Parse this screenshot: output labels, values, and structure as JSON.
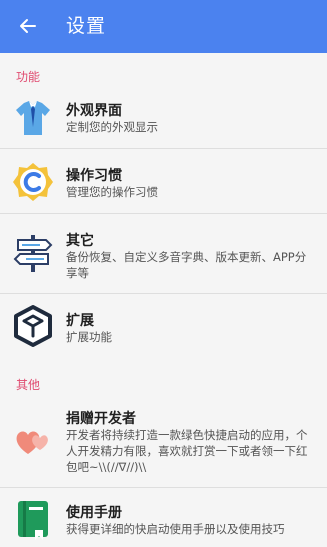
{
  "appbar": {
    "title": "设置",
    "back_icon": "arrow-left-icon"
  },
  "sections": {
    "features": {
      "label": "功能"
    },
    "other": {
      "label": "其他"
    }
  },
  "items": [
    {
      "title": "外观界面",
      "desc": "定制您的外观显示",
      "icon": "shirt-icon"
    },
    {
      "title": "操作习惯",
      "desc": "管理您的操作习惯",
      "icon": "c-gear-icon"
    },
    {
      "title": "其它",
      "desc": "备份恢复、自定义多音字典、版本更新、APP分享等",
      "icon": "signpost-icon"
    },
    {
      "title": "扩展",
      "desc": "扩展功能",
      "icon": "cube-icon"
    },
    {
      "title": "捐赠开发者",
      "desc": "开发者将持续打造一款绿色快捷启动的应用，个人开发精力有限，喜欢就打赏一下或者领一下红包吧~\\\\(//∇//)\\\\",
      "icon": "hearts-icon"
    },
    {
      "title": "使用手册",
      "desc": "获得更详细的快启动使用手册以及使用技巧",
      "icon": "book-icon"
    }
  ],
  "colors": {
    "appbar": "#4b82ef",
    "section_label": "#e04a6f"
  }
}
